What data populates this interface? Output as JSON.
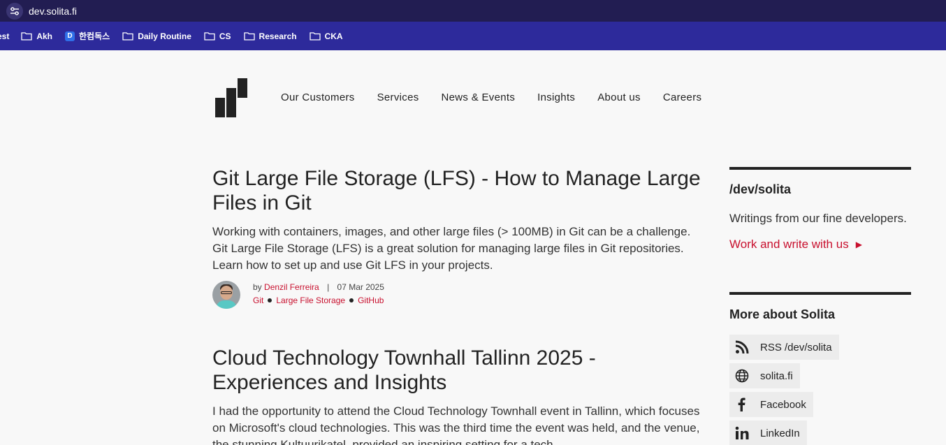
{
  "browser": {
    "url": "dev.solita.fi",
    "bookmarks": [
      {
        "label": "est",
        "icon": "none"
      },
      {
        "label": "Akh",
        "icon": "folder-icon"
      },
      {
        "label": "한컴독스",
        "icon": "app-d-icon",
        "badge": "D"
      },
      {
        "label": "Daily Routine",
        "icon": "folder-icon"
      },
      {
        "label": "CS",
        "icon": "folder-icon"
      },
      {
        "label": "Research",
        "icon": "folder-icon"
      },
      {
        "label": "CKA",
        "icon": "folder-icon"
      }
    ]
  },
  "nav": {
    "items": [
      "Our Customers",
      "Services",
      "News & Events",
      "Insights",
      "About us",
      "Careers"
    ]
  },
  "articles": [
    {
      "title": "Git Large File Storage (LFS) - How to Manage Large Files in Git",
      "summary": "Working with containers, images, and other large files (> 100MB) in Git can be a challenge. Git Large File Storage (LFS) is a great solution for managing large files in Git repositories. Learn how to set up and use Git LFS in your projects.",
      "by": "by",
      "author": "Denzil Ferreira",
      "date": "07 Mar 2025",
      "tags": [
        "Git",
        "Large File Storage",
        "GitHub"
      ]
    },
    {
      "title": "Cloud Technology Townhall Tallinn 2025 - Experiences and Insights",
      "summary": "I had the opportunity to attend the Cloud Technology Townhall event in Tallinn, which focuses on Microsoft's cloud technologies. This was the third time the event was held, and the venue, the stunning Kultuurikatel, provided an inspiring setting for a tech"
    }
  ],
  "sidebar": {
    "blog_title": "/dev/solita",
    "blog_desc": "Writings from our fine developers.",
    "cta": "Work and write with us",
    "more_title": "More about Solita",
    "links": [
      {
        "label": "RSS /dev/solita",
        "icon": "rss-icon"
      },
      {
        "label": "solita.fi",
        "icon": "globe-icon"
      },
      {
        "label": "Facebook",
        "icon": "facebook-icon"
      },
      {
        "label": "LinkedIn",
        "icon": "linkedin-icon"
      }
    ]
  },
  "colors": {
    "accent": "#c8102e",
    "urlbar": "#221d52",
    "bookmarks_bar": "#2d2a9b"
  }
}
